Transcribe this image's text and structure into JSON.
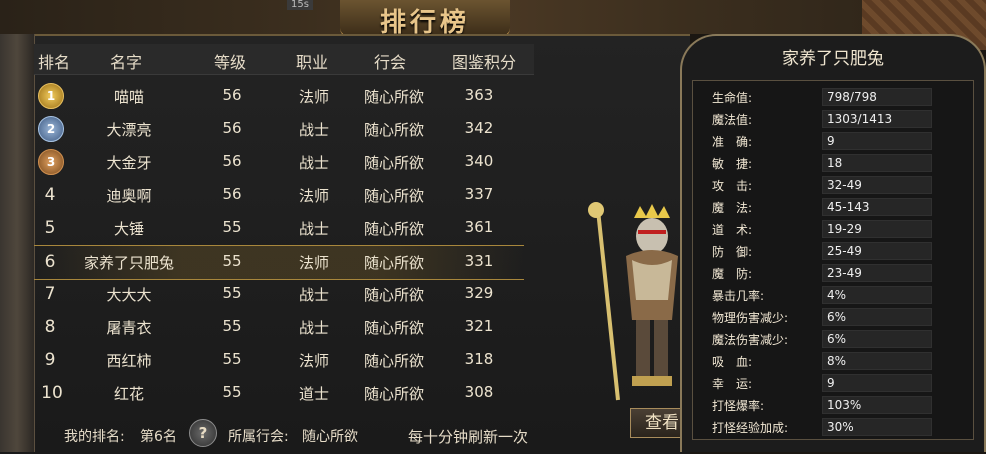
{
  "timer": "15s",
  "title": "排行榜",
  "columns": [
    "排名",
    "名字",
    "等级",
    "职业",
    "行会",
    "图鉴积分"
  ],
  "rows": [
    {
      "rank": "1",
      "name": "喵喵",
      "level": "56",
      "class": "法师",
      "guild": "随心所欲",
      "score": "363"
    },
    {
      "rank": "2",
      "name": "大漂亮",
      "level": "56",
      "class": "战士",
      "guild": "随心所欲",
      "score": "342"
    },
    {
      "rank": "3",
      "name": "大金牙",
      "level": "56",
      "class": "战士",
      "guild": "随心所欲",
      "score": "340"
    },
    {
      "rank": "4",
      "name": "迪奥啊",
      "level": "56",
      "class": "法师",
      "guild": "随心所欲",
      "score": "337"
    },
    {
      "rank": "5",
      "name": "大锤",
      "level": "55",
      "class": "战士",
      "guild": "随心所欲",
      "score": "361"
    },
    {
      "rank": "6",
      "name": "家养了只肥兔",
      "level": "55",
      "class": "法师",
      "guild": "随心所欲",
      "score": "331"
    },
    {
      "rank": "7",
      "name": "大大大",
      "level": "55",
      "class": "战士",
      "guild": "随心所欲",
      "score": "329"
    },
    {
      "rank": "8",
      "name": "屠青衣",
      "level": "55",
      "class": "战士",
      "guild": "随心所欲",
      "score": "321"
    },
    {
      "rank": "9",
      "name": "西红柿",
      "level": "55",
      "class": "法师",
      "guild": "随心所欲",
      "score": "318"
    },
    {
      "rank": "10",
      "name": "红花",
      "level": "55",
      "class": "道士",
      "guild": "随心所欲",
      "score": "308"
    }
  ],
  "footer": {
    "my_rank_label": "我的排名:",
    "my_rank_value": "第6名",
    "help_glyph": "?",
    "guild_label": "所属行会:",
    "guild_value": "随心所欲",
    "refresh_text": "每十分钟刷新一次"
  },
  "view_button": "查看",
  "stats_panel": {
    "title": "家养了只肥兔",
    "stats": [
      {
        "label": "生命值:",
        "value": "798/798"
      },
      {
        "label": "魔法值:",
        "value": "1303/1413"
      },
      {
        "label": "准　确:",
        "value": "9"
      },
      {
        "label": "敏　捷:",
        "value": "18"
      },
      {
        "label": "攻　击:",
        "value": "32-49"
      },
      {
        "label": "魔　法:",
        "value": "45-143"
      },
      {
        "label": "道　术:",
        "value": "19-29"
      },
      {
        "label": "防　御:",
        "value": "25-49"
      },
      {
        "label": "魔　防:",
        "value": "23-49"
      },
      {
        "label": "暴击几率:",
        "value": "4%"
      },
      {
        "label": "物理伤害减少:",
        "value": "6%"
      },
      {
        "label": "魔法伤害减少:",
        "value": "6%"
      },
      {
        "label": "吸　血:",
        "value": "8%"
      },
      {
        "label": "幸　运:",
        "value": "9"
      },
      {
        "label": "打怪爆率:",
        "value": "103%"
      },
      {
        "label": "打怪经验加成:",
        "value": "30%"
      }
    ]
  },
  "colors": {
    "highlight": "#a8873c",
    "medal_gold": "#f2cc5e",
    "medal_silver": "#9ab6d8",
    "medal_bronze": "#e0a060"
  },
  "icons": {
    "help": "question-mark-icon",
    "medals": [
      "gold-medal-icon",
      "silver-medal-icon",
      "bronze-medal-icon"
    ]
  }
}
